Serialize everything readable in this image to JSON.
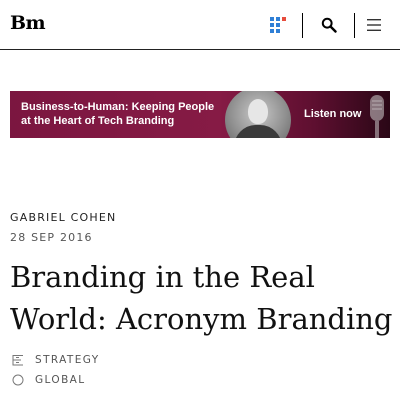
{
  "header": {
    "logo_text": "Bm",
    "icons": [
      "dashboard-grid-icon",
      "search-icon",
      "menu-icon"
    ],
    "accent_colors": [
      "#2f7fd6",
      "#e74c3c"
    ]
  },
  "banner": {
    "title": "Business-to-Human: Keeping People at the Heart of Tech Branding",
    "cta": "Listen now",
    "background_color": "#861b45"
  },
  "article": {
    "author": "GABRIEL COHEN",
    "date": "28 SEP 2016",
    "title": "Branding in the Real World: Acronym Branding",
    "tags": [
      {
        "label": "STRATEGY",
        "icon": "strategy-icon"
      },
      {
        "label": "GLOBAL",
        "icon": "globe-circle-icon"
      }
    ]
  }
}
